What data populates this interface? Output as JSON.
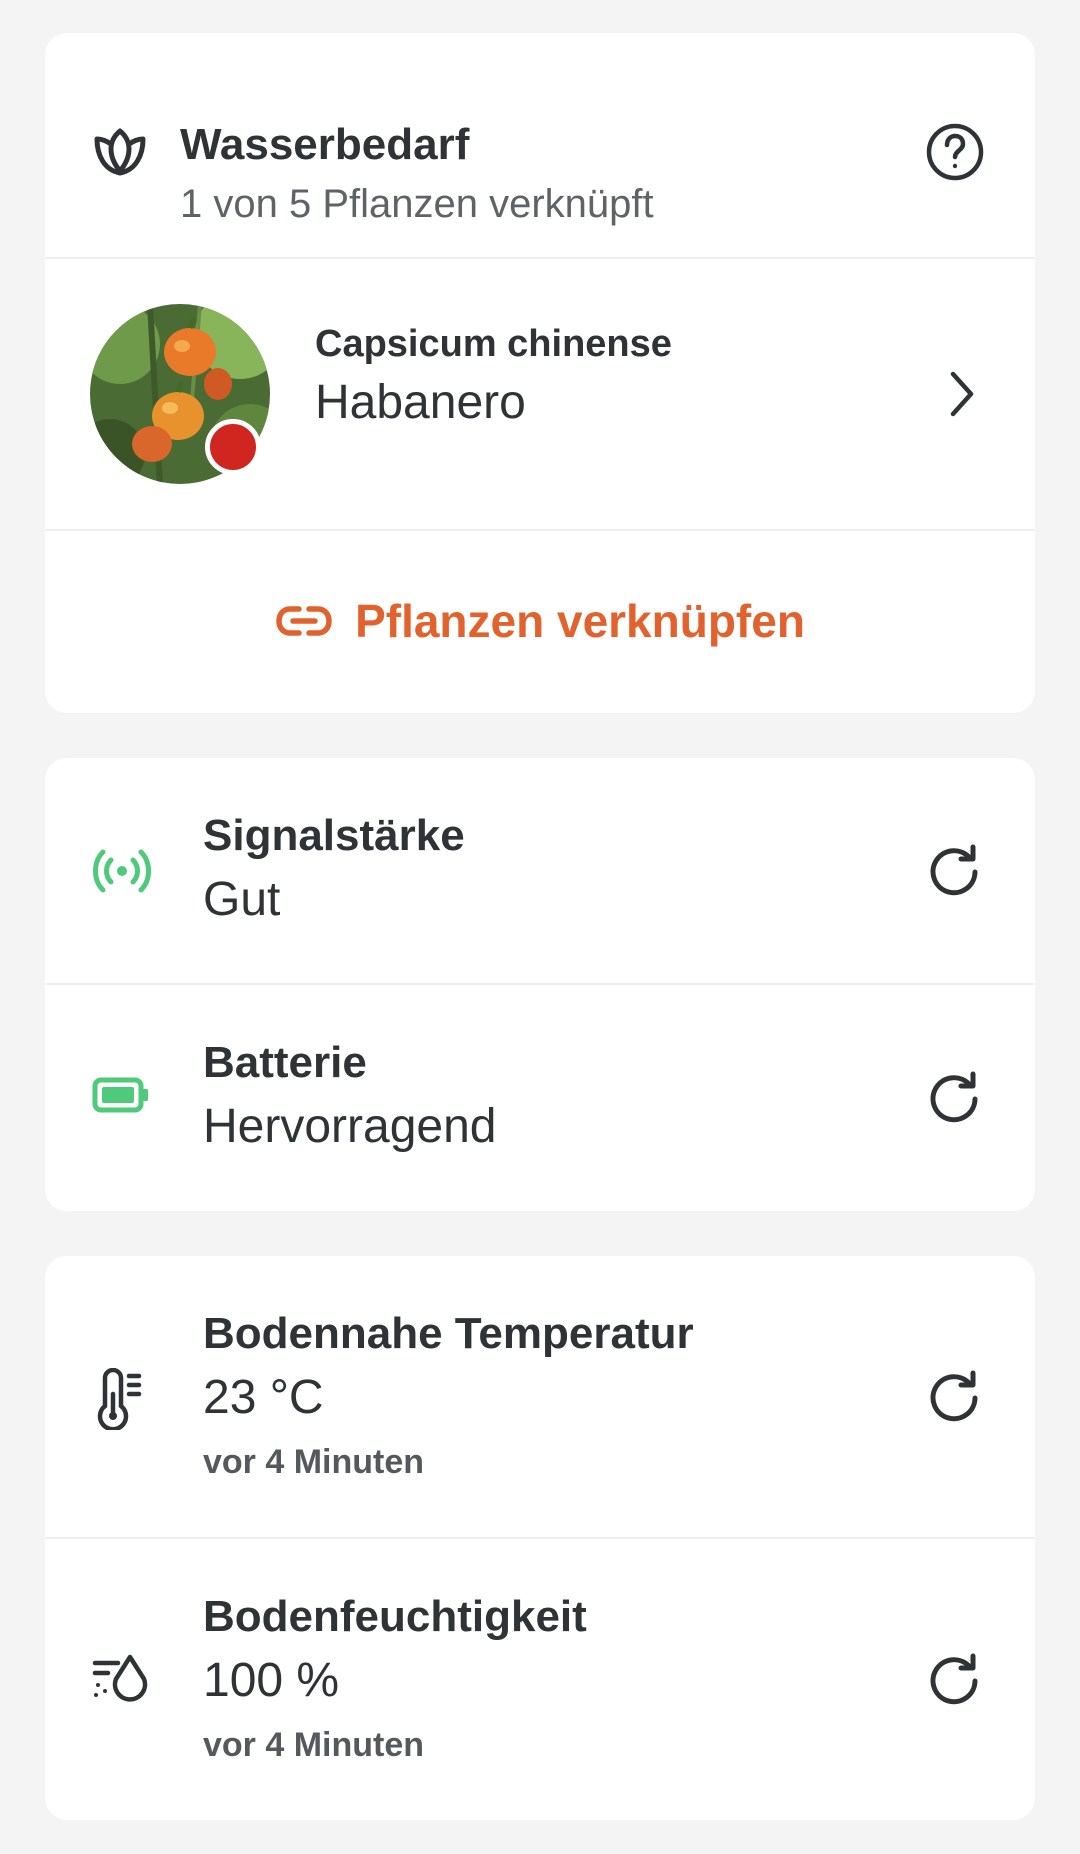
{
  "colors": {
    "accent": "#e1622c",
    "signal_good": "#4fc97a",
    "battery_good": "#4fc97a",
    "status_dot": "#d0261f",
    "text": "#2f3336"
  },
  "water": {
    "icon": "plant-bud-icon",
    "title": "Wasserbedarf",
    "subtitle": "1 von 5 Pflanzen verknüpft",
    "help_icon": "question-circle-icon"
  },
  "plant": {
    "scientific_name": "Capsicum chinense",
    "common_name": "Habanero",
    "chevron_icon": "chevron-right-icon"
  },
  "link_button": {
    "icon": "link-icon",
    "label": "Pflanzen verknüpfen"
  },
  "device": {
    "signal": {
      "icon": "signal-broadcast-icon",
      "title": "Signalstärke",
      "value": "Gut",
      "refresh_icon": "refresh-icon"
    },
    "battery": {
      "icon": "battery-icon",
      "title": "Batterie",
      "value": "Hervorragend",
      "refresh_icon": "refresh-icon"
    }
  },
  "sensors": {
    "temperature": {
      "icon": "thermometer-icon",
      "title": "Bodennahe Temperatur",
      "value": "23 °C",
      "updated": "vor 4 Minuten",
      "refresh_icon": "refresh-icon"
    },
    "moisture": {
      "icon": "soil-moisture-icon",
      "title": "Bodenfeuchtigkeit",
      "value": "100 %",
      "updated": "vor 4 Minuten",
      "refresh_icon": "refresh-icon"
    }
  }
}
